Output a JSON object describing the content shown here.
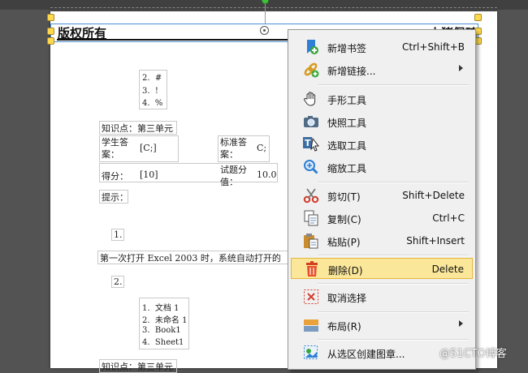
{
  "header": {
    "left_title": "版权所有",
    "right_title": "小猪佩琦"
  },
  "document": {
    "list1": [
      "#",
      "!",
      "%"
    ],
    "list1_nums": [
      "2.",
      "3.",
      "4."
    ],
    "knowledge_point": "知识点：第三单元",
    "student_answer_label": "学生答案：",
    "student_answer_value": "[C;]",
    "std_answer_label": "标准答案：",
    "std_answer_value": "C;",
    "score_label": "得分：",
    "score_value": "[10]",
    "question_score_label": "试题分值：",
    "question_score_value": "10.0",
    "hint_label": "提示：",
    "q1_num": "1.",
    "q1_text": "第一次打开 Excel 2003 时，系统自动打开的",
    "q2_num": "2.",
    "list2_nums": [
      "1.",
      "2.",
      "3.",
      "4."
    ],
    "list2": [
      "文档 1",
      "未命名 1",
      "Book1",
      "Sheet1"
    ],
    "knowledge_point_2": "知识点：第三单元"
  },
  "context_menu": {
    "items": [
      {
        "label": "新增书签",
        "shortcut": "Ctrl+Shift+B",
        "icon": "bookmark-add-icon"
      },
      {
        "label": "新增链接...",
        "shortcut": "",
        "submenu": true,
        "icon": "link-add-icon"
      },
      {
        "label": "手形工具",
        "shortcut": "",
        "icon": "hand-tool-icon"
      },
      {
        "label": "快照工具",
        "shortcut": "",
        "icon": "camera-icon"
      },
      {
        "label": "选取工具",
        "shortcut": "",
        "icon": "select-text-icon"
      },
      {
        "label": "缩放工具",
        "shortcut": "",
        "icon": "zoom-icon"
      },
      {
        "label": "剪切(T)",
        "shortcut": "Shift+Delete",
        "icon": "scissors-icon"
      },
      {
        "label": "复制(C)",
        "shortcut": "Ctrl+C",
        "icon": "copy-icon"
      },
      {
        "label": "粘贴(P)",
        "shortcut": "Shift+Insert",
        "icon": "paste-icon"
      },
      {
        "label": "删除(D)",
        "shortcut": "Delete",
        "icon": "delete-icon",
        "highlighted": true
      },
      {
        "label": "取消选择",
        "shortcut": "",
        "icon": "deselect-icon"
      },
      {
        "label": "布局(R)",
        "shortcut": "",
        "submenu": true,
        "icon": "layout-icon"
      },
      {
        "label": "从选区创建图章...",
        "shortcut": "",
        "icon": "stamp-icon"
      }
    ]
  },
  "watermark": "@51CTO博客",
  "colors": {
    "highlight_bg": "#fbe79a",
    "highlight_border": "#e4b53a",
    "selection_border": "#4a8fd6",
    "handle": "#ffd94d"
  }
}
